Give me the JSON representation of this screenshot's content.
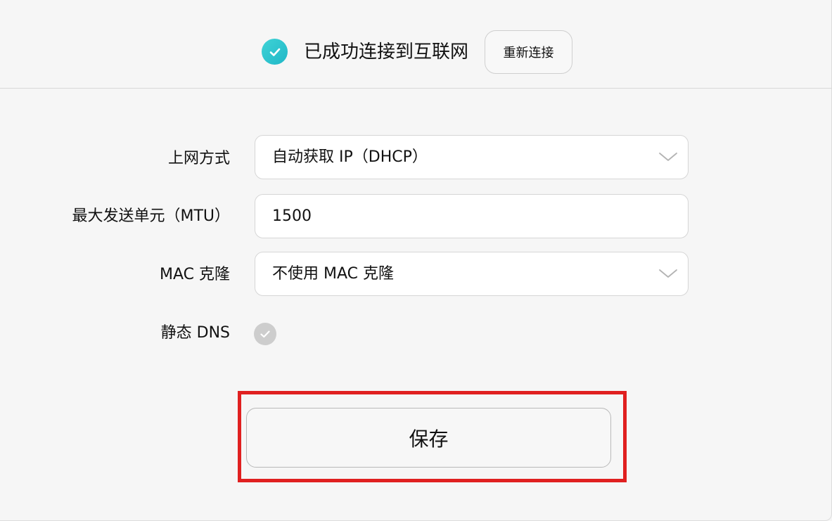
{
  "status": {
    "icon": "check-circle-icon",
    "text": "已成功连接到互联网",
    "reconnect_label": "重新连接",
    "accent_color": "#2ec4cf"
  },
  "form": {
    "connection_type": {
      "label": "上网方式",
      "value": "自动获取 IP（DHCP）",
      "icon": "chevron-down-icon"
    },
    "mtu": {
      "label": "最大发送单元（MTU）",
      "value": "1500"
    },
    "mac_clone": {
      "label": "MAC 克隆",
      "value": "不使用 MAC 克隆",
      "icon": "chevron-down-icon"
    },
    "static_dns": {
      "label": "静态 DNS",
      "checked": false,
      "icon": "check-circle-icon"
    }
  },
  "actions": {
    "save_label": "保存",
    "highlight_color": "#e02020"
  }
}
